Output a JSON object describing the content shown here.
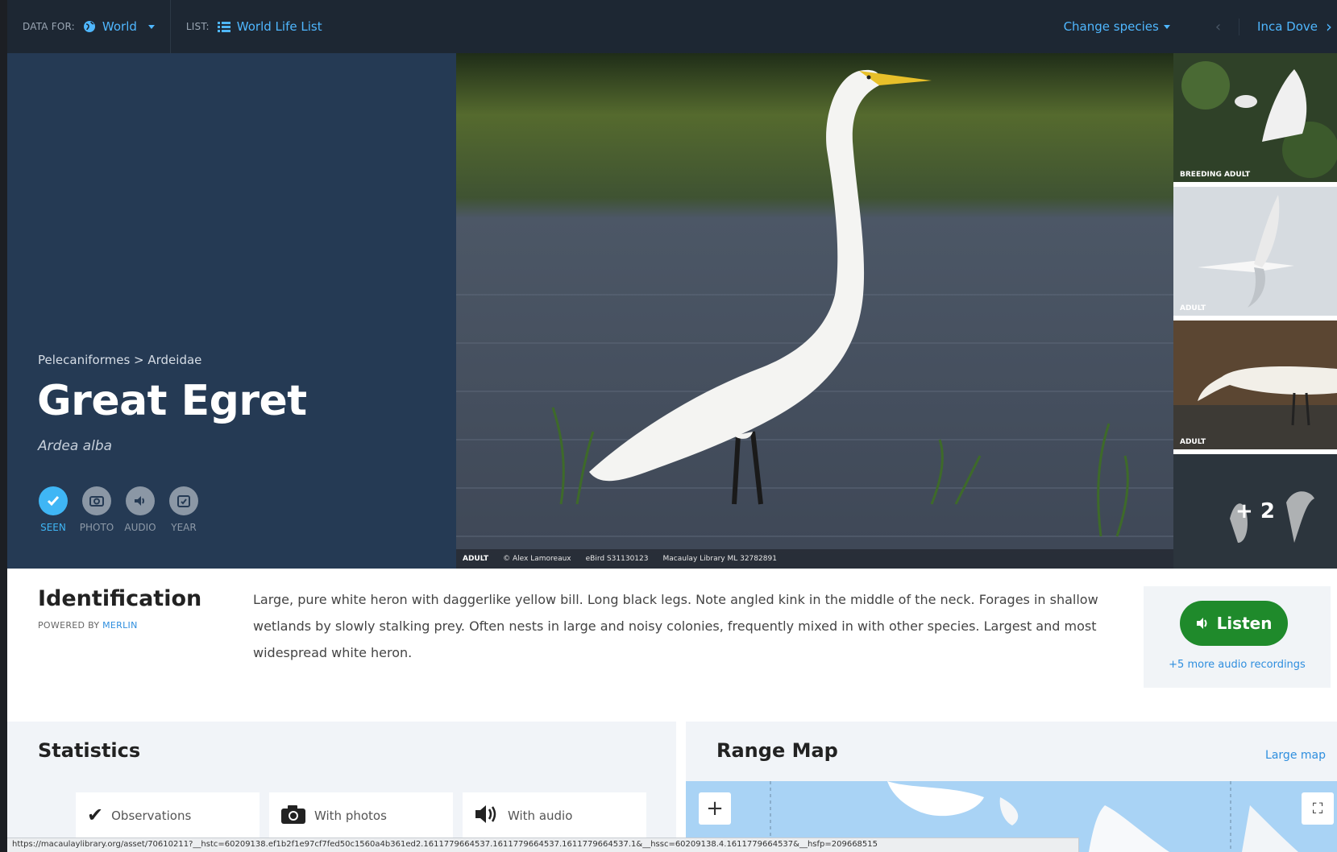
{
  "topbar": {
    "data_for_label": "DATA FOR:",
    "region": "World",
    "list_label": "LIST:",
    "list_name": "World Life List",
    "change_species": "Change species",
    "next_species": "Inca Dove"
  },
  "species": {
    "breadcrumb": "Pelecaniformes > Ardeidae",
    "common_name": "Great Egret",
    "scientific_name": "Ardea alba",
    "badges": [
      {
        "label": "SEEN",
        "icon": "check-icon",
        "active": true
      },
      {
        "label": "PHOTO",
        "icon": "camera-icon",
        "active": false
      },
      {
        "label": "AUDIO",
        "icon": "speaker-icon",
        "active": false
      },
      {
        "label": "YEAR",
        "icon": "calendar-check-icon",
        "active": false
      }
    ]
  },
  "photo": {
    "caption_tag": "ADULT",
    "credit": "© Alex Lamoreaux",
    "ebird": "eBird S31130123",
    "macaulay": "Macaulay Library ML 32782891"
  },
  "thumbnails": [
    {
      "tag": "BREEDING ADULT"
    },
    {
      "tag": "ADULT"
    },
    {
      "tag": "ADULT"
    },
    {
      "tag": "",
      "more": "+ 2"
    }
  ],
  "identification": {
    "title": "Identification",
    "powered_by": "POWERED BY",
    "powered_link": "MERLIN",
    "description": "Large, pure white heron with daggerlike yellow bill. Long black legs. Note angled kink in the middle of the neck. Forages in shallow wetlands by slowly stalking prey. Often nests in large and noisy colonies, frequently mixed in with other species. Largest and most widespread white heron.",
    "listen_label": "Listen",
    "more_audio": "+5 more audio recordings"
  },
  "statistics": {
    "title": "Statistics",
    "cards": [
      {
        "label": "Observations",
        "icon": "check-icon"
      },
      {
        "label": "With photos",
        "icon": "camera-icon"
      },
      {
        "label": "With audio",
        "icon": "speaker-icon"
      }
    ]
  },
  "range_map": {
    "title": "Range Map",
    "large_map": "Large map",
    "zoom_in": "+"
  },
  "statusbar": {
    "url": "https://macaulaylibrary.org/asset/70610211?__hstc=60209138.ef1b2f1e97cf7fed50c1560a4b361ed2.1611779664537.1611779664537.1611779664537.1&__hssc=60209138.4.1611779664537&__hsfp=209668515"
  },
  "colors": {
    "topbar_bg": "#1d2733",
    "hero_left_bg": "#253a54",
    "accent_blue": "#3fb6f5",
    "link_blue": "#2e8ede",
    "listen_green": "#1f8a2b"
  }
}
